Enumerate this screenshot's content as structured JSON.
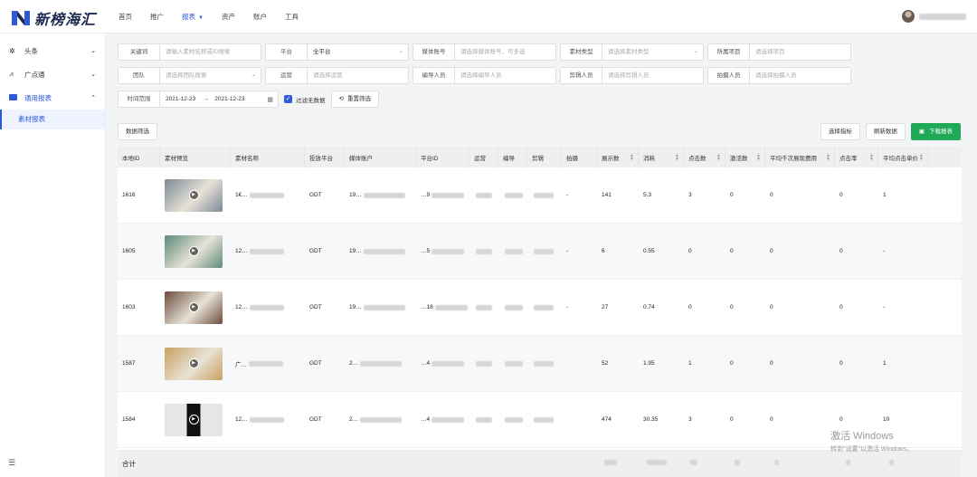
{
  "brand": {
    "name": "新榜海汇"
  },
  "nav": {
    "items": [
      "首页",
      "推广",
      "报表",
      "资产",
      "账户",
      "工具"
    ],
    "active": "报表"
  },
  "sidebar": {
    "items": [
      {
        "label": "头条",
        "icon": "toutiao-icon"
      },
      {
        "label": "广点通",
        "icon": "gdt-icon"
      },
      {
        "label": "通用报表",
        "icon": "report-icon"
      }
    ],
    "sub_item": "素材报表"
  },
  "filters": {
    "row1": [
      {
        "label": "关键词",
        "placeholder": "请输入素材名称或ID搜索"
      },
      {
        "label": "平台",
        "value": "全平台"
      },
      {
        "label": "媒体账号",
        "placeholder": "请选择媒体账号，可多选"
      },
      {
        "label": "素材类型",
        "placeholder": "请选择素材类型"
      },
      {
        "label": "所属项目",
        "placeholder": "请选择项目"
      }
    ],
    "row2": [
      {
        "label": "团队",
        "placeholder": "请选择团队搜索"
      },
      {
        "label": "运营",
        "placeholder": "请选择运营"
      },
      {
        "label": "编导人员",
        "placeholder": "请选择编导人员"
      },
      {
        "label": "剪辑人员",
        "placeholder": "请选择剪辑人员"
      },
      {
        "label": "拍摄人员",
        "placeholder": "请选择拍摄人员"
      }
    ],
    "time_label": "时间范围",
    "date_start": "2021-12-23",
    "date_end": "2021-12-23",
    "filter_no_data": "过滤无数据",
    "reset": "重置筛选"
  },
  "toolbar": {
    "data_filter": "数据筛选",
    "select_metrics": "选择指标",
    "refresh": "刷新数据",
    "download": "下载报表"
  },
  "table": {
    "columns": [
      "本地ID",
      "素材预览",
      "素材名称",
      "投放平台",
      "媒体账户",
      "平台ID",
      "运营",
      "编导",
      "剪辑",
      "拍摄",
      "展示数",
      "消耗",
      "点击数",
      "激活数",
      "平均千次展现费用",
      "点击率",
      "平均点击单价"
    ],
    "rows": [
      {
        "id": "1616",
        "name": "1€…",
        "platform": "GDT",
        "account": "19…",
        "pid": "…9",
        "operator": "",
        "director": "",
        "editor": "",
        "shooter": "-",
        "impressions": "141",
        "cost": "5.3",
        "clicks": "3",
        "activations": "0",
        "cpm": "0",
        "ctr": "0",
        "cpc": "1",
        "thumb": "#7b8a96"
      },
      {
        "id": "1605",
        "name": "12…",
        "platform": "GDT",
        "account": "19…",
        "pid": "…5",
        "operator": "",
        "director": "",
        "editor": "",
        "shooter": "-",
        "impressions": "6",
        "cost": "0.55",
        "clicks": "0",
        "activations": "0",
        "cpm": "0",
        "ctr": "0",
        "cpc": "-",
        "thumb": "#5c8a7a"
      },
      {
        "id": "1603",
        "name": "12…",
        "platform": "GDT",
        "account": "19…",
        "pid": "…18",
        "operator": "",
        "director": "",
        "editor": "",
        "shooter": "-",
        "impressions": "27",
        "cost": "0.74",
        "clicks": "0",
        "activations": "0",
        "cpm": "0",
        "ctr": "0",
        "cpc": "-",
        "thumb": "#6a4c3c"
      },
      {
        "id": "1587",
        "name": "广…",
        "platform": "GDT",
        "account": "2…",
        "pid": "…4",
        "operator": "",
        "director": "",
        "editor": "",
        "shooter": "",
        "impressions": "52",
        "cost": "1.95",
        "clicks": "1",
        "activations": "0",
        "cpm": "0",
        "ctr": "0",
        "cpc": "1",
        "thumb": "#c9a060"
      },
      {
        "id": "1584",
        "name": "12…",
        "platform": "GDT",
        "account": "2…",
        "pid": "…4",
        "operator": "",
        "director": "",
        "editor": "",
        "shooter": "",
        "impressions": "474",
        "cost": "30.35",
        "clicks": "3",
        "activations": "0",
        "cpm": "0",
        "ctr": "0",
        "cpc": "10",
        "thumb": "#111111"
      }
    ],
    "total_label": "合计"
  },
  "watermark": {
    "line1": "激活 Windows",
    "line2": "转到\"设置\"以激活 Windows。"
  },
  "colors": {
    "primary": "#2d5bd8",
    "download": "#1fa855"
  }
}
